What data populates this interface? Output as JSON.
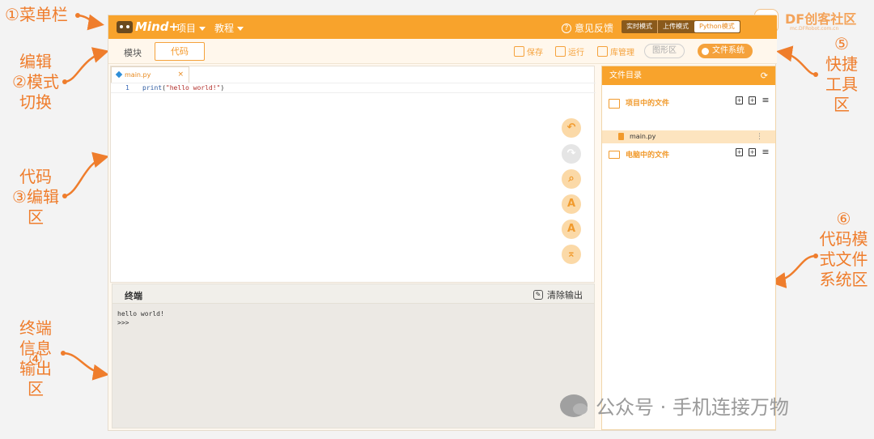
{
  "annotations": {
    "a1": {
      "num": "①",
      "label": "菜单栏"
    },
    "a2": {
      "num": "②",
      "lines": [
        "编辑",
        "模式",
        "切换"
      ]
    },
    "a3": {
      "num": "③",
      "lines": [
        "代码",
        "编辑",
        "区"
      ]
    },
    "a4": {
      "num": "④",
      "lines": [
        "终端",
        "信息",
        "输出",
        "区"
      ]
    },
    "a5": {
      "num": "⑤",
      "lines": [
        "快捷",
        "工具",
        "区"
      ]
    },
    "a6": {
      "num": "⑥",
      "lines": [
        "代码模",
        "式文件",
        "系统区"
      ]
    }
  },
  "menubar": {
    "logo": "Mind+",
    "menu_project": "项目",
    "menu_tutorial": "教程",
    "feedback": "意见反馈",
    "modes": [
      "实时模式",
      "上传模式",
      "Python模式"
    ]
  },
  "toolbar": {
    "tab_blocks": "模块",
    "tab_code": "代码",
    "save": "保存",
    "run": "运行",
    "library": "库管理",
    "graphic": "图形区",
    "file_system": "文件系统"
  },
  "editor": {
    "tab_name": "main.py",
    "close": "×",
    "lines": [
      {
        "no": "1",
        "fn": "print",
        "open": "(",
        "str": "\"hello world!\"",
        "close": ")"
      }
    ],
    "buttons": [
      "undo",
      "redo",
      "find",
      "font-increase",
      "font-decrease",
      "go-top"
    ]
  },
  "terminal": {
    "title": "终端",
    "clear_label": "清除输出",
    "output": [
      "hello world!",
      ">>>"
    ]
  },
  "files": {
    "title": "文件目录",
    "project_files": "项目中的文件",
    "project_items": [
      "main.py"
    ],
    "computer_files": "电脑中的文件"
  },
  "brand": {
    "title": "DF创客社区",
    "sub": "mc.DFRobot.com.cn"
  },
  "watermark": "公众号 · 手机连接万物",
  "colors": {
    "accent": "#f8a32c",
    "annotation": "#ef7d2c"
  }
}
